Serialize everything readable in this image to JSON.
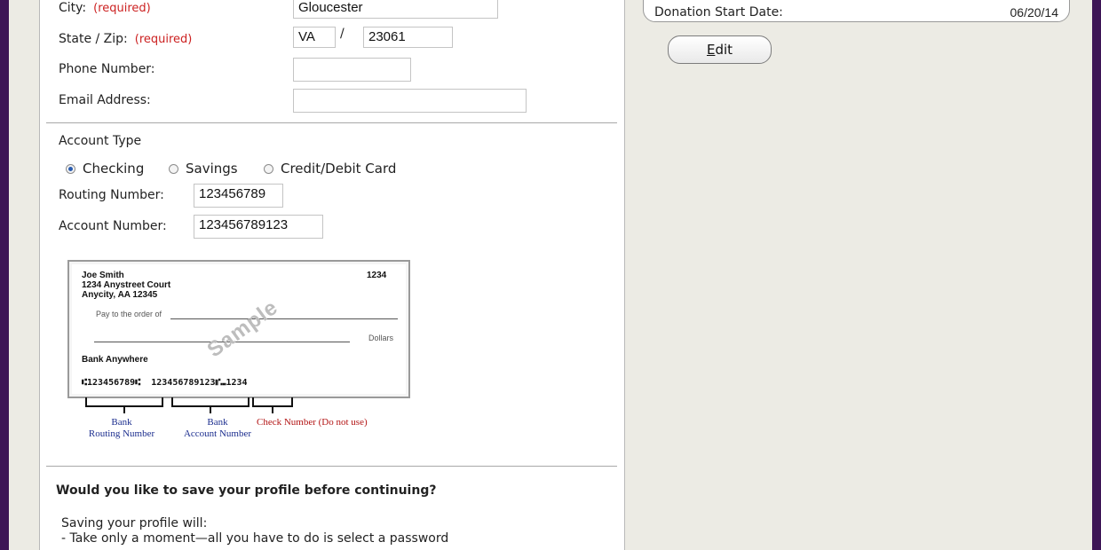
{
  "form": {
    "city_label": "City:",
    "city_req": "(required)",
    "city_value": "Gloucester",
    "state_zip_label": "State / Zip:",
    "state_zip_req": "(required)",
    "state_value": "VA",
    "state_zip_sep": "/",
    "zip_value": "23061",
    "phone_label": "Phone Number:",
    "phone_value": "",
    "email_label": "Email Address:",
    "email_value": ""
  },
  "account": {
    "type_label": "Account Type",
    "options": [
      {
        "label": "Checking",
        "selected": true
      },
      {
        "label": "Savings",
        "selected": false
      },
      {
        "label": "Credit/Debit Card",
        "selected": false
      }
    ],
    "routing_label": "Routing Number:",
    "routing_value": "123456789",
    "account_label": "Account Number:",
    "account_value": "123456789123"
  },
  "check_sample": {
    "name": "Joe Smith",
    "address1": "1234 Anystreet Court",
    "address2": "Anycity, AA 12345",
    "check_no": "1234",
    "pay_to": "Pay to the order of",
    "dollars": "Dollars",
    "bank": "Bank Anywhere",
    "micr_routing": "123456789",
    "micr_account": "123456789123",
    "micr_check": "1234",
    "watermark": "Sample",
    "caption_routing_1": "Bank",
    "caption_routing_2": "Routing Number",
    "caption_account_1": "Bank",
    "caption_account_2": "Account Number",
    "caption_check": "Check Number (Do not use)",
    "colors": {
      "routing": "#1d2f8f",
      "account": "#1d2f8f",
      "check": "#b31515"
    }
  },
  "profile": {
    "question": "Would you like to save your profile before continuing?",
    "intro": "Saving your profile will:",
    "bullet1": "- Take only a moment—all you have to do is select a password"
  },
  "summary": {
    "start_date_label": "Donation Start Date:",
    "start_date_value": "06/20/14"
  },
  "edit_button": {
    "prefix": "E",
    "rest": "dit"
  },
  "colors": {
    "outer": "#3d1556",
    "background": "#ecebe4",
    "required": "#cc2222"
  }
}
